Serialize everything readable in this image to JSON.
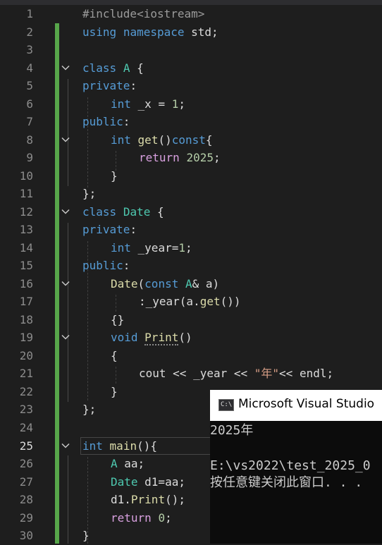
{
  "editor": {
    "line_numbers": [
      "1",
      "2",
      "3",
      "4",
      "5",
      "6",
      "7",
      "8",
      "9",
      "10",
      "11",
      "12",
      "13",
      "14",
      "15",
      "16",
      "17",
      "18",
      "19",
      "20",
      "21",
      "22",
      "23",
      "24",
      "25",
      "26",
      "27",
      "28",
      "29",
      "30"
    ],
    "tokens": {
      "l1_pp": "#include<iostream>",
      "l2_kw1": "using",
      "l2_kw2": "namespace",
      "l2_rest": " std;",
      "l4_kw": "class",
      "l4_cls": "A",
      "l4_rest": " {",
      "l5_kw": "private",
      "l5_rest": ":",
      "l6_kw": "int",
      "l6_rest": " _x = ",
      "l6_num": "1",
      "l6_end": ";",
      "l7_kw": "public",
      "l7_rest": ":",
      "l8_kw": "int",
      "l8_fn": "get",
      "l8_p": "()",
      "l8_kw2": "const",
      "l8_end": "{",
      "l9_kw": "return",
      "l9_num": "2025",
      "l9_end": ";",
      "l10": "}",
      "l11": "};",
      "l12_kw": "class",
      "l12_cls": "Date",
      "l12_rest": " {",
      "l13_kw": "private",
      "l13_rest": ":",
      "l14_kw": "int",
      "l14_rest": " _year=",
      "l14_num": "1",
      "l14_end": ";",
      "l15_kw": "public",
      "l15_rest": ":",
      "l16_cls": "Date",
      "l16_p": "(",
      "l16_kw": "const",
      "l16_cls2": "A",
      "l16_rest": "& a)",
      "l17_rest1": ":_year(a.",
      "l17_fn": "get",
      "l17_rest2": "())",
      "l18": "{}",
      "l19_kw": "void",
      "l19_fn": "Print",
      "l19_rest": "()",
      "l20": "{",
      "l21_rest1": "cout << _year << ",
      "l21_str": "\"年\"",
      "l21_rest2": "<< endl;",
      "l22": "}",
      "l23": "};",
      "l25_kw": "int",
      "l25_fn": "main",
      "l25_rest": "(){",
      "l26_cls": "A",
      "l26_rest": " aa;",
      "l27_cls": "Date",
      "l27_rest": " d1=aa;",
      "l28_rest1": "d1.",
      "l28_fn": "Print",
      "l28_rest2": "();",
      "l29_kw": "return",
      "l29_num": "0",
      "l29_end": ";",
      "l30": "}"
    },
    "active_line": "25"
  },
  "console": {
    "title": "Microsoft Visual Studio",
    "icon_label": "C:\\",
    "output_line1": "2025年",
    "output_line2": "E:\\vs2022\\test_2025_0",
    "output_line3": "按任意键关闭此窗口. . ."
  },
  "colors": {
    "background": "#1e1e1e",
    "keyword": "#569cd6",
    "control_keyword": "#d8a0df",
    "type": "#4ec9b0",
    "function": "#dcdcaa",
    "number": "#b5cea8",
    "string": "#d69d85",
    "change_bar": "#57a64a"
  },
  "icons": [
    "chevron-down-icon",
    "console-app-icon"
  ]
}
